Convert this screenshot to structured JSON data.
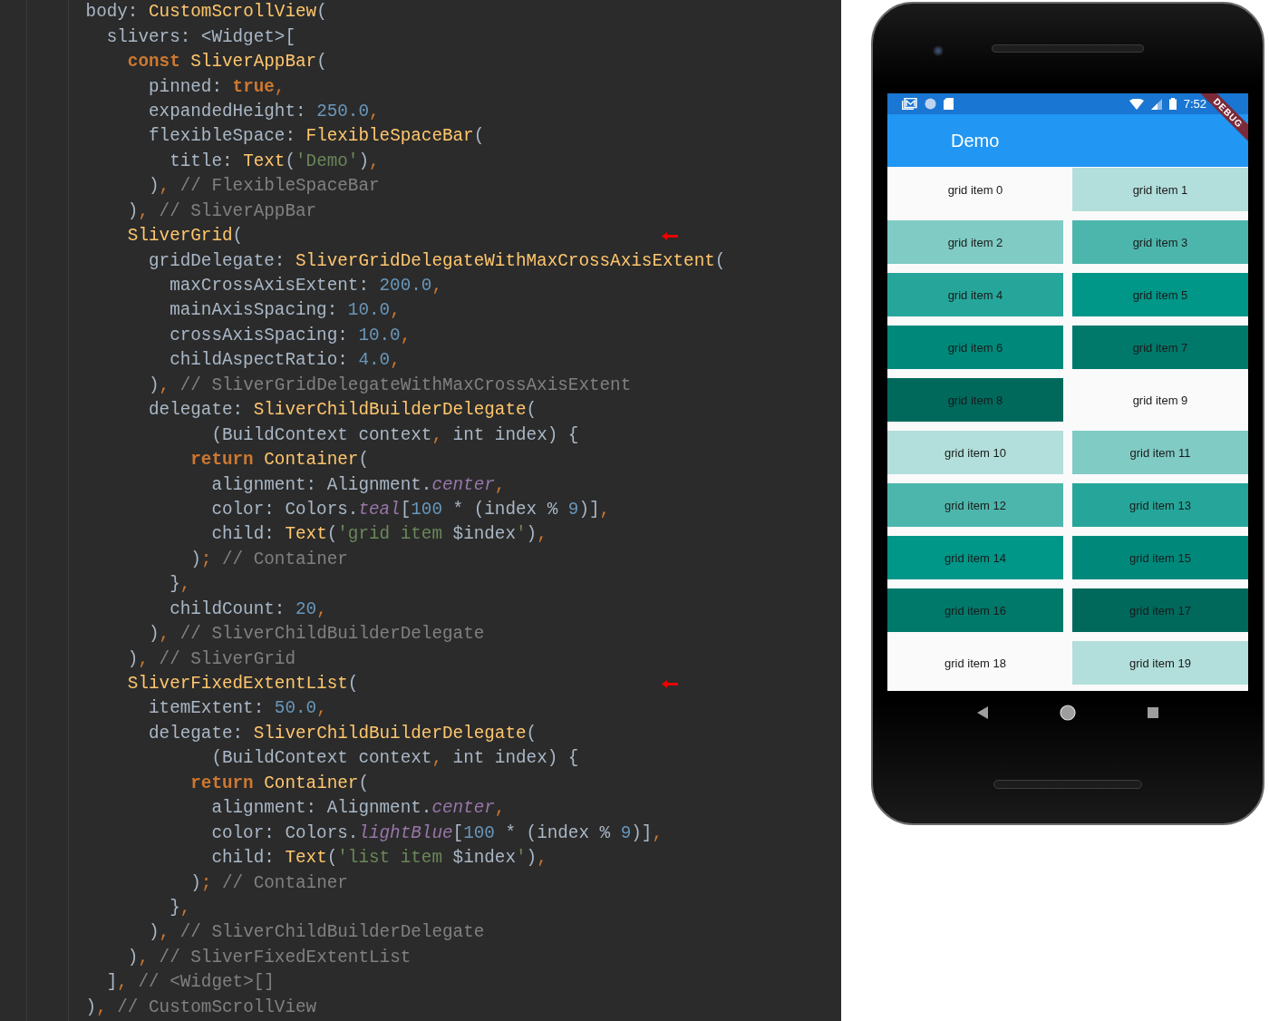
{
  "code_lines": [
    {
      "marked": false,
      "tokens": [
        {
          "text": "        body: ",
          "kind": "plain"
        },
        {
          "text": "CustomScrollView",
          "kind": "cls"
        },
        {
          "text": "(",
          "kind": "plain"
        }
      ]
    },
    {
      "marked": false,
      "tokens": [
        {
          "text": "          slivers: <Widget>[",
          "kind": "plain"
        }
      ]
    },
    {
      "marked": false,
      "tokens": [
        {
          "text": "            const ",
          "kind": "kw"
        },
        {
          "text": "SliverAppBar",
          "kind": "cls"
        },
        {
          "text": "(",
          "kind": "plain"
        }
      ]
    },
    {
      "marked": false,
      "tokens": [
        {
          "text": "              pinned: ",
          "kind": "plain"
        },
        {
          "text": "true",
          "kind": "kw"
        },
        {
          "text": ",",
          "kind": "punct"
        }
      ]
    },
    {
      "marked": false,
      "tokens": [
        {
          "text": "              expandedHeight: ",
          "kind": "plain"
        },
        {
          "text": "250.0",
          "kind": "num"
        },
        {
          "text": ",",
          "kind": "punct"
        }
      ]
    },
    {
      "marked": false,
      "tokens": [
        {
          "text": "              flexibleSpace: ",
          "kind": "plain"
        },
        {
          "text": "FlexibleSpaceBar",
          "kind": "cls"
        },
        {
          "text": "(",
          "kind": "plain"
        }
      ]
    },
    {
      "marked": false,
      "tokens": [
        {
          "text": "                title: ",
          "kind": "plain"
        },
        {
          "text": "Text",
          "kind": "cls"
        },
        {
          "text": "(",
          "kind": "plain"
        },
        {
          "text": "'Demo'",
          "kind": "str"
        },
        {
          "text": ")",
          "kind": "plain"
        },
        {
          "text": ",",
          "kind": "punct"
        }
      ]
    },
    {
      "marked": false,
      "tokens": [
        {
          "text": "              )",
          "kind": "plain"
        },
        {
          "text": ", ",
          "kind": "punct"
        },
        {
          "text": "// FlexibleSpaceBar",
          "kind": "comment"
        }
      ]
    },
    {
      "marked": false,
      "tokens": [
        {
          "text": "            )",
          "kind": "plain"
        },
        {
          "text": ", ",
          "kind": "punct"
        },
        {
          "text": "// SliverAppBar",
          "kind": "comment"
        }
      ]
    },
    {
      "marked": true,
      "tokens": [
        {
          "text": "            SliverGrid",
          "kind": "cls"
        },
        {
          "text": "(",
          "kind": "plain"
        }
      ]
    },
    {
      "marked": false,
      "tokens": [
        {
          "text": "              gridDelegate: ",
          "kind": "plain"
        },
        {
          "text": "SliverGridDelegateWithMaxCrossAxisExtent",
          "kind": "cls"
        },
        {
          "text": "(",
          "kind": "plain"
        }
      ]
    },
    {
      "marked": false,
      "tokens": [
        {
          "text": "                maxCrossAxisExtent: ",
          "kind": "plain"
        },
        {
          "text": "200.0",
          "kind": "num"
        },
        {
          "text": ",",
          "kind": "punct"
        }
      ]
    },
    {
      "marked": false,
      "tokens": [
        {
          "text": "                mainAxisSpacing: ",
          "kind": "plain"
        },
        {
          "text": "10.0",
          "kind": "num"
        },
        {
          "text": ",",
          "kind": "punct"
        }
      ]
    },
    {
      "marked": false,
      "tokens": [
        {
          "text": "                crossAxisSpacing: ",
          "kind": "plain"
        },
        {
          "text": "10.0",
          "kind": "num"
        },
        {
          "text": ",",
          "kind": "punct"
        }
      ]
    },
    {
      "marked": false,
      "tokens": [
        {
          "text": "                childAspectRatio: ",
          "kind": "plain"
        },
        {
          "text": "4.0",
          "kind": "num"
        },
        {
          "text": ",",
          "kind": "punct"
        }
      ]
    },
    {
      "marked": false,
      "tokens": [
        {
          "text": "              )",
          "kind": "plain"
        },
        {
          "text": ", ",
          "kind": "punct"
        },
        {
          "text": "// SliverGridDelegateWithMaxCrossAxisExtent",
          "kind": "comment"
        }
      ]
    },
    {
      "marked": false,
      "tokens": [
        {
          "text": "              delegate: ",
          "kind": "plain"
        },
        {
          "text": "SliverChildBuilderDelegate",
          "kind": "cls"
        },
        {
          "text": "(",
          "kind": "plain"
        }
      ]
    },
    {
      "marked": false,
      "tokens": [
        {
          "text": "                    (BuildContext context",
          "kind": "plain"
        },
        {
          "text": ", ",
          "kind": "punct"
        },
        {
          "text": "int index) {",
          "kind": "plain"
        }
      ]
    },
    {
      "marked": false,
      "tokens": [
        {
          "text": "                  return ",
          "kind": "kw"
        },
        {
          "text": "Container",
          "kind": "cls"
        },
        {
          "text": "(",
          "kind": "plain"
        }
      ]
    },
    {
      "marked": false,
      "tokens": [
        {
          "text": "                    alignment: Alignment.",
          "kind": "plain"
        },
        {
          "text": "center",
          "kind": "italic"
        },
        {
          "text": ",",
          "kind": "punct"
        }
      ]
    },
    {
      "marked": false,
      "tokens": [
        {
          "text": "                    color: Colors.",
          "kind": "plain"
        },
        {
          "text": "teal",
          "kind": "italic"
        },
        {
          "text": "[",
          "kind": "plain"
        },
        {
          "text": "100",
          "kind": "num"
        },
        {
          "text": " * (index % ",
          "kind": "plain"
        },
        {
          "text": "9",
          "kind": "num"
        },
        {
          "text": ")]",
          "kind": "plain"
        },
        {
          "text": ",",
          "kind": "punct"
        }
      ]
    },
    {
      "marked": false,
      "tokens": [
        {
          "text": "                    child: ",
          "kind": "plain"
        },
        {
          "text": "Text",
          "kind": "cls"
        },
        {
          "text": "(",
          "kind": "plain"
        },
        {
          "text": "'grid item ",
          "kind": "str"
        },
        {
          "text": "$index",
          "kind": "plain"
        },
        {
          "text": "'",
          "kind": "str"
        },
        {
          "text": ")",
          "kind": "plain"
        },
        {
          "text": ",",
          "kind": "punct"
        }
      ]
    },
    {
      "marked": false,
      "tokens": [
        {
          "text": "                  )",
          "kind": "plain"
        },
        {
          "text": "; ",
          "kind": "punct"
        },
        {
          "text": "// Container",
          "kind": "comment"
        }
      ]
    },
    {
      "marked": false,
      "tokens": [
        {
          "text": "                }",
          "kind": "plain"
        },
        {
          "text": ",",
          "kind": "punct"
        }
      ]
    },
    {
      "marked": false,
      "tokens": [
        {
          "text": "                childCount: ",
          "kind": "plain"
        },
        {
          "text": "20",
          "kind": "num"
        },
        {
          "text": ",",
          "kind": "punct"
        }
      ]
    },
    {
      "marked": false,
      "tokens": [
        {
          "text": "              )",
          "kind": "plain"
        },
        {
          "text": ", ",
          "kind": "punct"
        },
        {
          "text": "// SliverChildBuilderDelegate",
          "kind": "comment"
        }
      ]
    },
    {
      "marked": false,
      "tokens": [
        {
          "text": "            )",
          "kind": "plain"
        },
        {
          "text": ", ",
          "kind": "punct"
        },
        {
          "text": "// SliverGrid",
          "kind": "comment"
        }
      ]
    },
    {
      "marked": true,
      "tokens": [
        {
          "text": "            SliverFixedExtentList",
          "kind": "cls"
        },
        {
          "text": "(",
          "kind": "plain"
        }
      ]
    },
    {
      "marked": false,
      "tokens": [
        {
          "text": "              itemExtent: ",
          "kind": "plain"
        },
        {
          "text": "50.0",
          "kind": "num"
        },
        {
          "text": ",",
          "kind": "punct"
        }
      ]
    },
    {
      "marked": false,
      "tokens": [
        {
          "text": "              delegate: ",
          "kind": "plain"
        },
        {
          "text": "SliverChildBuilderDelegate",
          "kind": "cls"
        },
        {
          "text": "(",
          "kind": "plain"
        }
      ]
    },
    {
      "marked": false,
      "tokens": [
        {
          "text": "                    (BuildContext context",
          "kind": "plain"
        },
        {
          "text": ", ",
          "kind": "punct"
        },
        {
          "text": "int index) {",
          "kind": "plain"
        }
      ]
    },
    {
      "marked": false,
      "tokens": [
        {
          "text": "                  return ",
          "kind": "kw"
        },
        {
          "text": "Container",
          "kind": "cls"
        },
        {
          "text": "(",
          "kind": "plain"
        }
      ]
    },
    {
      "marked": false,
      "tokens": [
        {
          "text": "                    alignment: Alignment.",
          "kind": "plain"
        },
        {
          "text": "center",
          "kind": "italic"
        },
        {
          "text": ",",
          "kind": "punct"
        }
      ]
    },
    {
      "marked": false,
      "tokens": [
        {
          "text": "                    color: Colors.",
          "kind": "plain"
        },
        {
          "text": "lightBlue",
          "kind": "italic"
        },
        {
          "text": "[",
          "kind": "plain"
        },
        {
          "text": "100",
          "kind": "num"
        },
        {
          "text": " * (index % ",
          "kind": "plain"
        },
        {
          "text": "9",
          "kind": "num"
        },
        {
          "text": ")]",
          "kind": "plain"
        },
        {
          "text": ",",
          "kind": "punct"
        }
      ]
    },
    {
      "marked": false,
      "tokens": [
        {
          "text": "                    child: ",
          "kind": "plain"
        },
        {
          "text": "Text",
          "kind": "cls"
        },
        {
          "text": "(",
          "kind": "plain"
        },
        {
          "text": "'list item ",
          "kind": "str"
        },
        {
          "text": "$index",
          "kind": "plain"
        },
        {
          "text": "'",
          "kind": "str"
        },
        {
          "text": ")",
          "kind": "plain"
        },
        {
          "text": ",",
          "kind": "punct"
        }
      ]
    },
    {
      "marked": false,
      "tokens": [
        {
          "text": "                  )",
          "kind": "plain"
        },
        {
          "text": "; ",
          "kind": "punct"
        },
        {
          "text": "// Container",
          "kind": "comment"
        }
      ]
    },
    {
      "marked": false,
      "tokens": [
        {
          "text": "                }",
          "kind": "plain"
        },
        {
          "text": ",",
          "kind": "punct"
        }
      ]
    },
    {
      "marked": false,
      "tokens": [
        {
          "text": "              )",
          "kind": "plain"
        },
        {
          "text": ", ",
          "kind": "punct"
        },
        {
          "text": "// SliverChildBuilderDelegate",
          "kind": "comment"
        }
      ]
    },
    {
      "marked": false,
      "tokens": [
        {
          "text": "            )",
          "kind": "plain"
        },
        {
          "text": ", ",
          "kind": "punct"
        },
        {
          "text": "// SliverFixedExtentList",
          "kind": "comment"
        }
      ]
    },
    {
      "marked": false,
      "tokens": [
        {
          "text": "          ]",
          "kind": "plain"
        },
        {
          "text": ", ",
          "kind": "punct"
        },
        {
          "text": "// <Widget>[]",
          "kind": "comment"
        }
      ]
    },
    {
      "marked": false,
      "tokens": [
        {
          "text": "        )",
          "kind": "plain"
        },
        {
          "text": ", ",
          "kind": "punct"
        },
        {
          "text": "// CustomScrollView",
          "kind": "comment"
        }
      ]
    }
  ],
  "phone": {
    "status_bar": {
      "time": "7:52"
    },
    "debug_banner": "DEBUG",
    "app_bar": {
      "title": "Demo"
    },
    "grid_items": [
      {
        "label": "grid item 0",
        "color": "#fafafa"
      },
      {
        "label": "grid item 1",
        "color": "#b2dfdb"
      },
      {
        "label": "grid item 2",
        "color": "#80cbc4"
      },
      {
        "label": "grid item 3",
        "color": "#4db6ac"
      },
      {
        "label": "grid item 4",
        "color": "#26a69a"
      },
      {
        "label": "grid item 5",
        "color": "#009688"
      },
      {
        "label": "grid item 6",
        "color": "#00897b"
      },
      {
        "label": "grid item 7",
        "color": "#00796b"
      },
      {
        "label": "grid item 8",
        "color": "#00695c"
      },
      {
        "label": "grid item 9",
        "color": "#fafafa"
      },
      {
        "label": "grid item 10",
        "color": "#b2dfdb"
      },
      {
        "label": "grid item 11",
        "color": "#80cbc4"
      },
      {
        "label": "grid item 12",
        "color": "#4db6ac"
      },
      {
        "label": "grid item 13",
        "color": "#26a69a"
      },
      {
        "label": "grid item 14",
        "color": "#009688"
      },
      {
        "label": "grid item 15",
        "color": "#00897b"
      },
      {
        "label": "grid item 16",
        "color": "#00796b"
      },
      {
        "label": "grid item 17",
        "color": "#00695c"
      },
      {
        "label": "grid item 18",
        "color": "#fafafa"
      },
      {
        "label": "grid item 19",
        "color": "#b2dfdb"
      }
    ]
  }
}
